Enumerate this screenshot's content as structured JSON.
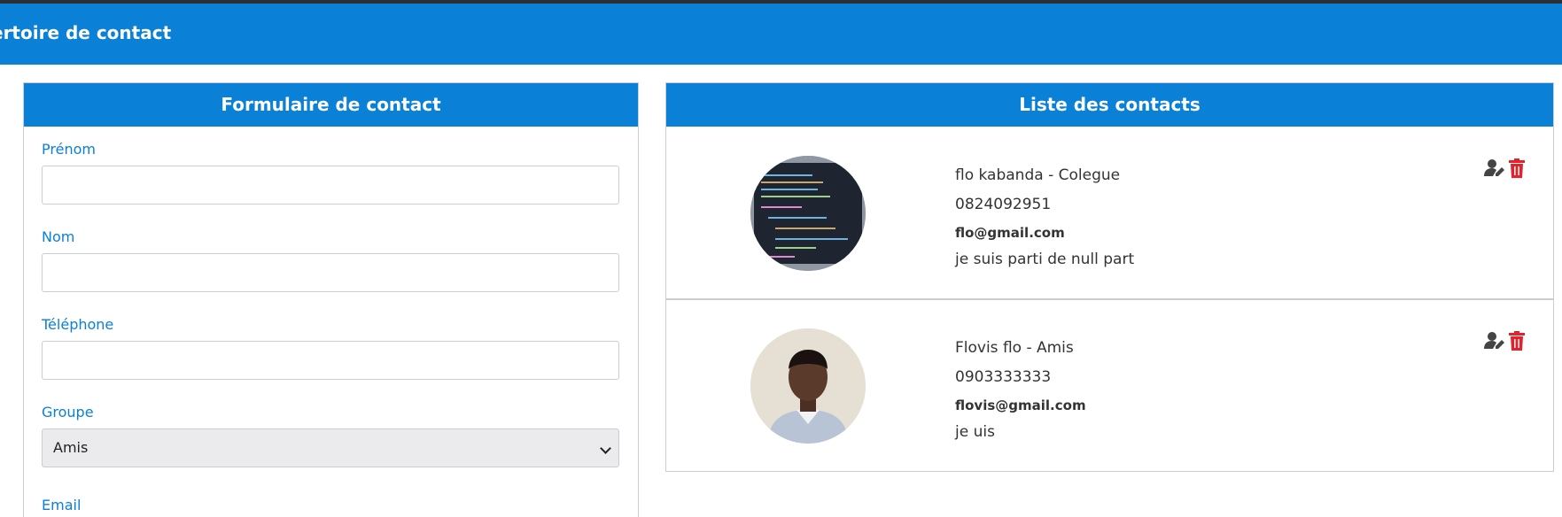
{
  "header": {
    "title": "ertoire de contact"
  },
  "form": {
    "title": "Formulaire de contact",
    "fields": [
      {
        "label": "Prénom",
        "value": ""
      },
      {
        "label": "Nom",
        "value": ""
      },
      {
        "label": "Téléphone",
        "value": ""
      }
    ],
    "group": {
      "label": "Groupe",
      "selected": "Amis"
    },
    "email_label": "Email"
  },
  "list": {
    "title": "Liste des contacts",
    "contacts": [
      {
        "name": "flo kabanda - Colegue",
        "phone": "0824092951",
        "email": "flo@gmail.com",
        "description": "je suis parti de null part",
        "avatar": "code-screenshot"
      },
      {
        "name": "Flovis flo - Amis",
        "phone": "0903333333",
        "email": "flovis@gmail.com",
        "description": "je uis",
        "avatar": "person-portrait"
      }
    ]
  },
  "colors": {
    "primary": "#0a80d7",
    "delete": "#e8202a",
    "edit": "#444444"
  },
  "icons": {
    "edit": "user-edit-icon",
    "delete": "trash-icon",
    "select": "chevron-down-icon"
  }
}
